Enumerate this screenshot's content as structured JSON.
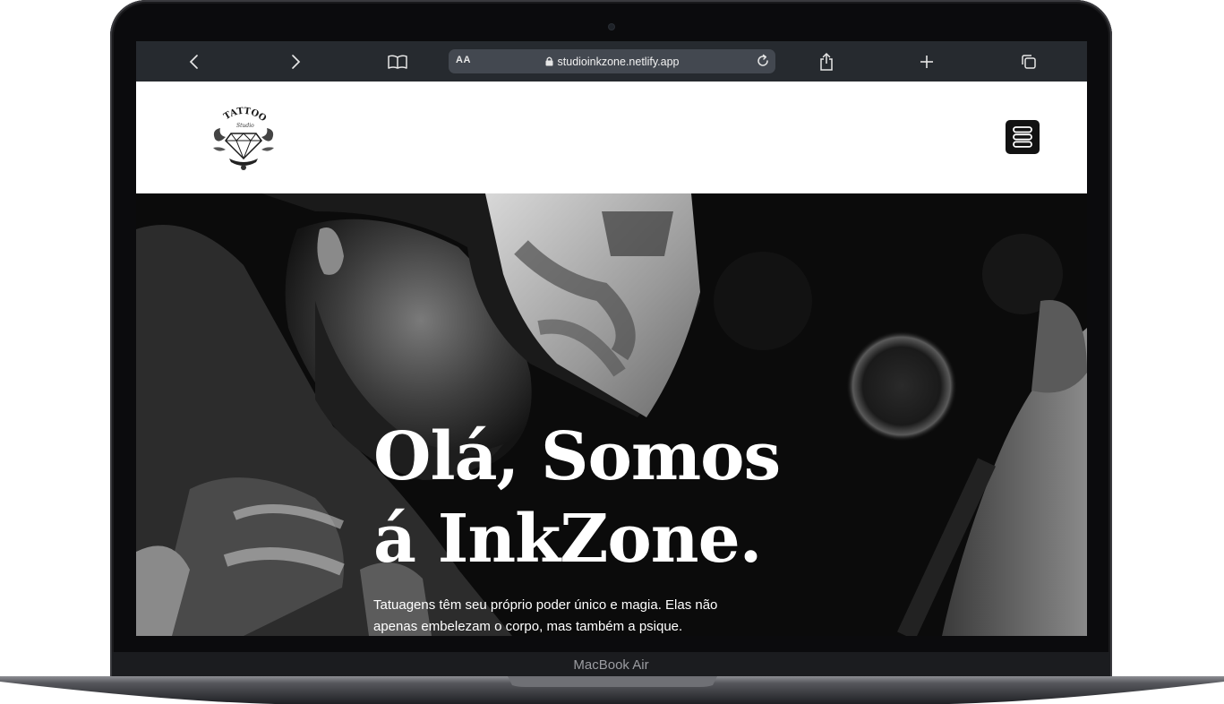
{
  "device": {
    "label": "MacBook Air"
  },
  "browser": {
    "url": "studioinkzone.netlify.app",
    "text_size_label": "AA",
    "icons": {
      "back": "chevron-left-icon",
      "forward": "chevron-right-icon",
      "bookmarks": "book-icon",
      "lock": "lock-icon",
      "reload": "reload-icon",
      "share": "share-icon",
      "new_tab": "plus-icon",
      "tabs": "tabs-icon"
    }
  },
  "site": {
    "logo": {
      "word": "TATTOO",
      "script": "Studio",
      "icon": "diamond-logo-icon"
    },
    "menu_icon": "menu-icon",
    "hero": {
      "title_line1": "Olá, Somos",
      "title_line2": "á InkZone.",
      "text": "Tatuagens têm seu próprio poder único e magia. Elas não apenas embelezam o corpo, mas também a psique."
    },
    "colors": {
      "toolbar": "#262a2f",
      "address_bar": "#434850",
      "menu_button": "#121212",
      "hero_text": "#ffffff"
    }
  }
}
